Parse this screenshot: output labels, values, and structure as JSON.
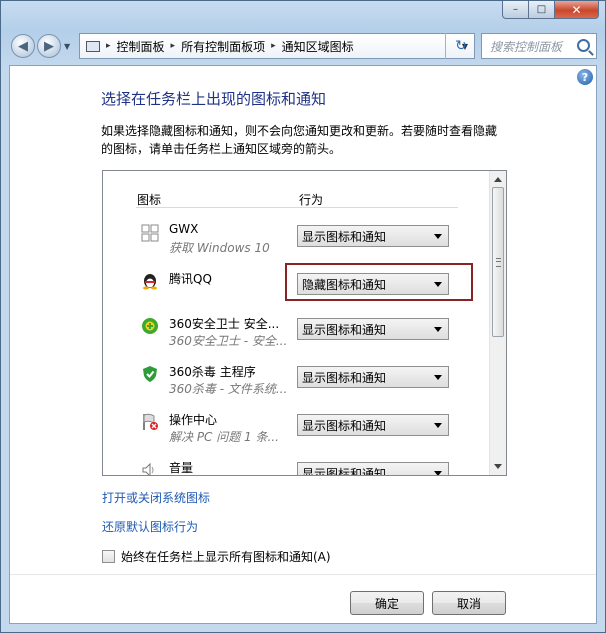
{
  "window": {
    "min": "–",
    "max": "□",
    "close": "✕"
  },
  "nav": {
    "back": "◀",
    "forward": "▶",
    "crumbs": [
      "控制面板",
      "所有控制面板项",
      "通知区域图标"
    ],
    "crumb_sep": "▸",
    "refresh": "↻",
    "search_placeholder": "搜索控制面板"
  },
  "content": {
    "help": "?",
    "title": "选择在任务栏上出现的图标和通知",
    "description": "如果选择隐藏图标和通知，则不会向您通知更改和更新。若要随时查看隐藏的图标，请单击任务栏上通知区域旁的箭头。",
    "list": {
      "header_icon": "图标",
      "header_behavior": "行为",
      "items": [
        {
          "name": "GWX",
          "sub": "获取 Windows 10",
          "behavior": "显示图标和通知",
          "icon": "windows-logo-icon"
        },
        {
          "name": "腾讯QQ",
          "sub": "",
          "behavior": "隐藏图标和通知",
          "icon": "qq-penguin-icon"
        },
        {
          "name": "360安全卫士 安全...",
          "sub": "360安全卫士 - 安全...",
          "behavior": "显示图标和通知",
          "icon": "360-safeguard-icon"
        },
        {
          "name": "360杀毒 主程序",
          "sub": "360杀毒 - 文件系统...",
          "behavior": "显示图标和通知",
          "icon": "360-antivirus-shield-icon"
        },
        {
          "name": "操作中心",
          "sub": "解决 PC 问题 1 条...",
          "behavior": "显示图标和通知",
          "icon": "action-center-flag-icon"
        },
        {
          "name": "音量",
          "sub": "",
          "behavior": "显示图标和通知",
          "icon": "speaker-icon"
        }
      ]
    },
    "link_system_icons": "打开或关闭系统图标",
    "link_restore": "还原默认图标行为",
    "always_show_label": "始终在任务栏上显示所有图标和通知(A)",
    "always_show_checked": false,
    "ok": "确定",
    "cancel": "取消"
  },
  "colors": {
    "title": "#1e3287",
    "link": "#1e5ab3",
    "highlight_box": "#8a2323"
  }
}
